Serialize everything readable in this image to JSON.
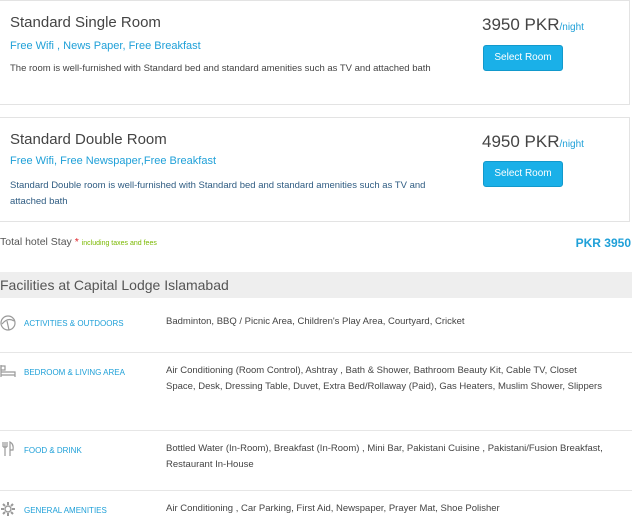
{
  "rooms": [
    {
      "name": "Standard Single Room",
      "amenities": "Free Wifi , News Paper, Free Breakfast",
      "description": "The room is well-furnished with Standard bed and standard amenities such as TV and attached bath",
      "price": "3950 PKR",
      "per": "/night",
      "button_label": "Select Room"
    },
    {
      "name": "Standard Double Room",
      "amenities": "Free Wifi, Free Newspaper,Free Breakfast",
      "description": "Standard Double room is well-furnished with Standard bed and standard amenities such as TV and attached bath",
      "price": "4950 PKR",
      "per": "/night",
      "button_label": "Select Room"
    }
  ],
  "total": {
    "label": "Total hotel Stay",
    "star": "*",
    "note": "including taxes and fees",
    "value": "PKR 3950"
  },
  "facilities": {
    "title": "Facilities at Capital Lodge Islamabad",
    "rows": [
      {
        "icon": "beach-umbrella-icon",
        "category": "ACTIVITIES & OUTDOORS",
        "items": "Badminton, BBQ / Picnic Area, Children's Play Area, Courtyard, Cricket"
      },
      {
        "icon": "bed-icon",
        "category": "BEDROOM & LIVING AREA",
        "items": "Air Conditioning (Room Control), Ashtray , Bath & Shower, Bathroom Beauty Kit, Cable TV, Closet Space, Desk, Dressing Table, Duvet, Extra Bed/Rollaway (Paid), Gas Heaters, Muslim Shower, Slippers"
      },
      {
        "icon": "cutlery-icon",
        "category": "FOOD & DRINK",
        "items": "Bottled Water (In-Room), Breakfast (In-Room) , Mini Bar, Pakistani Cuisine , Pakistani/Fusion Breakfast, Restaurant In-House"
      },
      {
        "icon": "gear-icon",
        "category": "GENERAL AMENITIES",
        "items": "Air Conditioning , Car Parking, First Aid, Newspaper, Prayer Mat, Shoe Polisher"
      }
    ]
  },
  "colors": {
    "accent": "#1fa0d8",
    "button": "#1ab0e8",
    "star": "#e0242b",
    "note": "#7ab800"
  }
}
